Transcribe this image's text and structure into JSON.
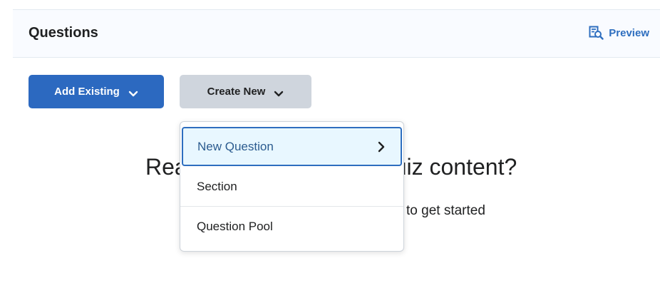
{
  "header": {
    "title": "Questions",
    "preview_label": "Preview"
  },
  "toolbar": {
    "add_existing_label": "Add Existing",
    "create_new_label": "Create New"
  },
  "empty_state": {
    "heading_left": "Rea",
    "heading_right": "uiz content?",
    "sub_right": "to get started"
  },
  "dropdown": {
    "items": [
      {
        "label": "New Question",
        "has_submenu": true,
        "active": true
      },
      {
        "label": "Section"
      },
      {
        "label": "Question Pool"
      }
    ]
  },
  "colors": {
    "primary": "#2c69c0",
    "link": "#2e6ebf",
    "secondary_button": "#cfd5dd",
    "active_item_bg": "#e8f7ff"
  }
}
